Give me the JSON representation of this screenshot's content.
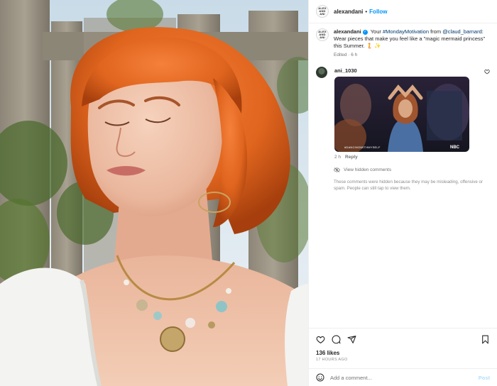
{
  "post": {
    "account_logo_text": "ALEX AND ANI",
    "username": "alexandani",
    "separator": "•",
    "follow_label": "Follow",
    "more_label": "•••"
  },
  "caption": {
    "username": "alexandani",
    "text_before": " Your ",
    "hashtag": "#MondayMotivation",
    "text_mid": " from ",
    "mention": "@claud_barnard",
    "text_after": ": Wear pieces that make you feel like a \"magic mermaid princess\" this Summer. 🧜 ✨",
    "meta": "Edited · 6 h"
  },
  "comment": {
    "username": "ani_1030",
    "gif_caption": "#DANCINGWITHMYSELF",
    "gif_watermark": "NBC",
    "time": "2 h",
    "reply_label": "Reply"
  },
  "hidden": {
    "label": "View hidden comments",
    "note": "These comments were hidden because they may be misleading, offensive or spam. People can still tap to view them."
  },
  "footer": {
    "likes": "136 likes",
    "time_ago": "17 HOURS AGO",
    "comment_placeholder": "Add a comment...",
    "post_label": "Post"
  },
  "icons": {
    "heart": "heart-icon",
    "comment": "comment-icon",
    "share": "share-icon",
    "save": "bookmark-icon",
    "emoji": "emoji-icon",
    "hidden": "eye-slash-icon",
    "verified": "verified-badge-icon"
  },
  "colors": {
    "accent": "#0095f6",
    "post_disabled": "#b2dffc",
    "hair": "#e0651e"
  }
}
